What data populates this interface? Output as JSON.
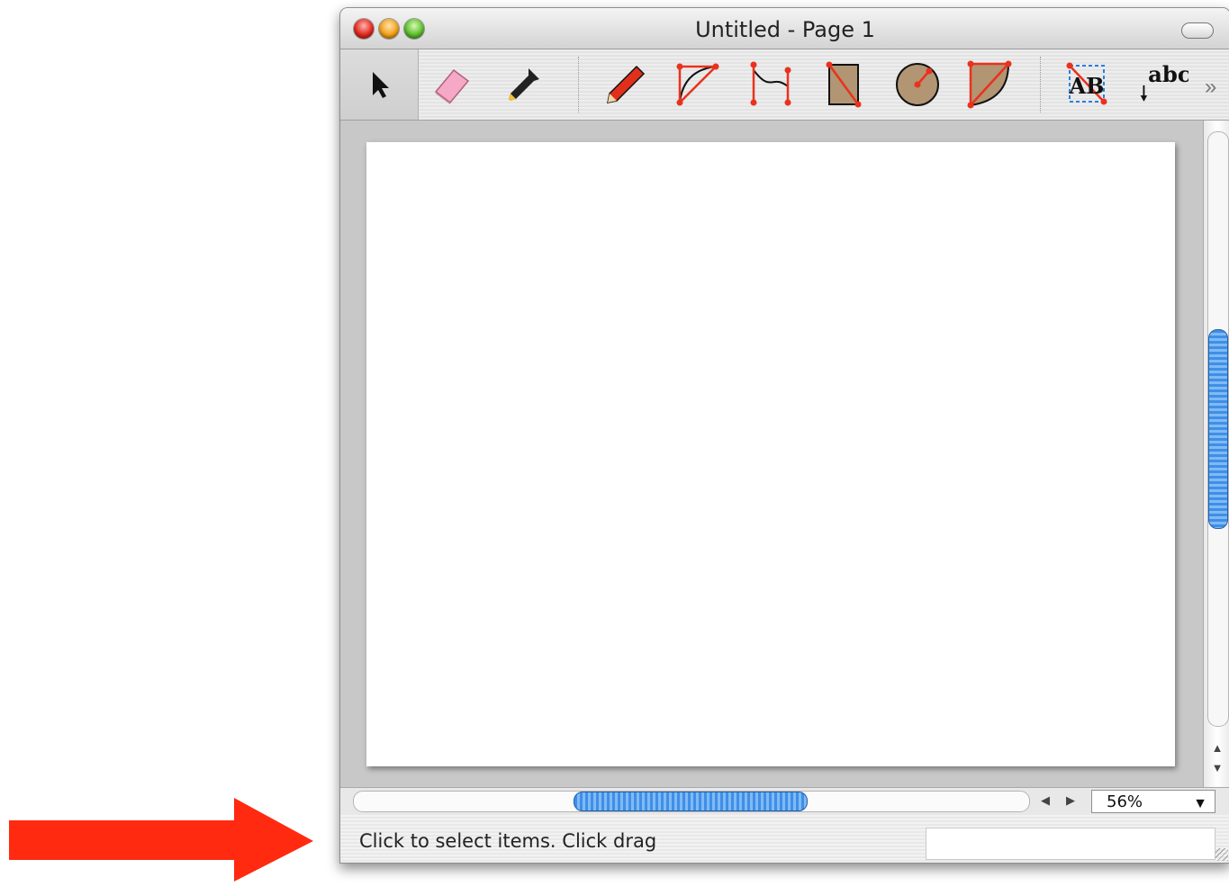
{
  "window": {
    "title": "Untitled - Page 1"
  },
  "toolbar": {
    "tools": [
      {
        "name": "select-tool",
        "icon": "arrow-pointer-icon"
      },
      {
        "name": "eraser-tool",
        "icon": "eraser-icon"
      },
      {
        "name": "eyedropper-tool",
        "icon": "eyedropper-icon"
      },
      {
        "name": "pencil-tool",
        "icon": "pencil-icon"
      },
      {
        "name": "arc-tool",
        "icon": "arc-icon"
      },
      {
        "name": "curve-tool",
        "icon": "curve-icon"
      },
      {
        "name": "rectangle-tool",
        "icon": "rectangle-icon"
      },
      {
        "name": "circle-tool",
        "icon": "circle-icon"
      },
      {
        "name": "pie-tool",
        "icon": "pie-icon"
      },
      {
        "name": "text-box-tool",
        "icon": "text-box-icon"
      },
      {
        "name": "text-tool",
        "icon": "text-icon"
      }
    ],
    "text_box_label": "AB",
    "text_tool_label": "abc",
    "overflow_glyph": "»"
  },
  "zoom": {
    "value": "56%"
  },
  "status": {
    "message": "Click to select items. Click drag"
  },
  "colors": {
    "accent_red": "#e8321e",
    "shape_fill": "#b29573",
    "scroll_blue": "#3f8fe6",
    "annotation_arrow": "#ff2a10"
  }
}
